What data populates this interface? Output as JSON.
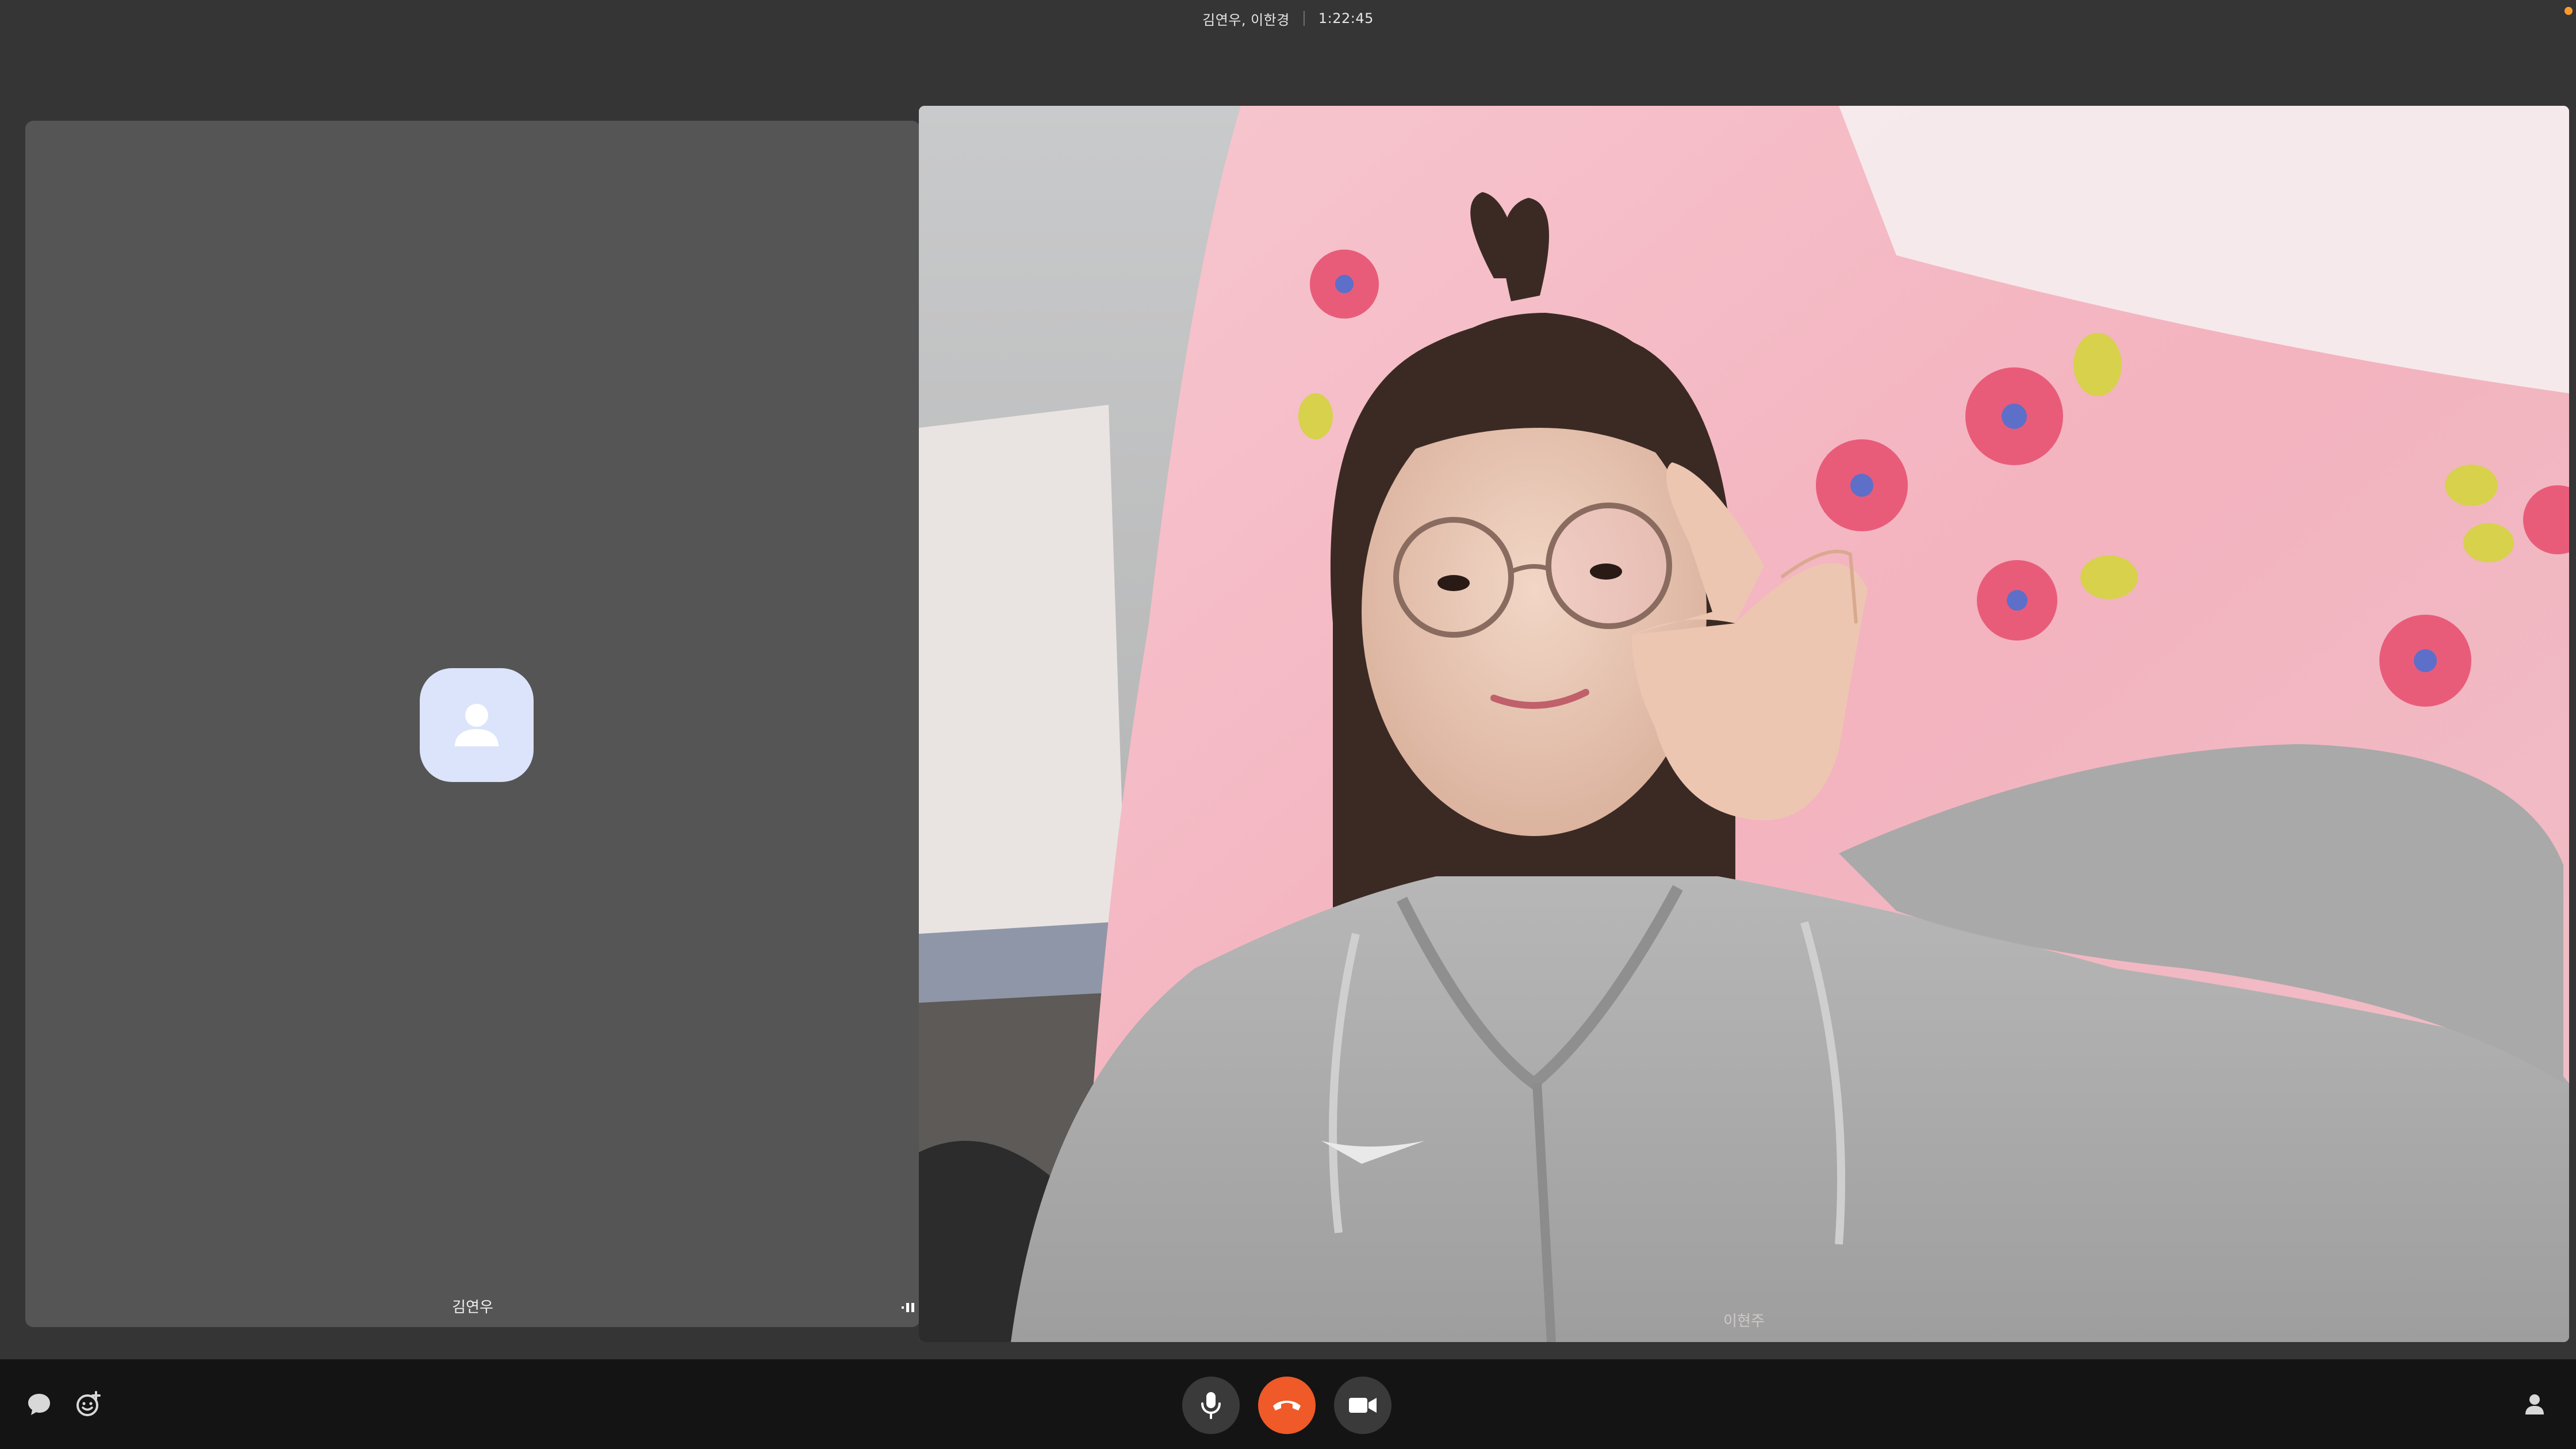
{
  "window": {
    "participants_title": "김연우, 이한경",
    "call_timer": "1:22:45"
  },
  "tiles": {
    "left": {
      "name": "김연우",
      "video": "off",
      "avatar_icon": "person-icon"
    },
    "right": {
      "name": "이현주",
      "video": "on"
    }
  },
  "controls": {
    "mic_icon": "microphone-icon",
    "end_call_icon": "phone-hangup-icon",
    "camera_icon": "video-camera-icon",
    "chat_icon": "chat-bubble-icon",
    "emoji_icon": "emoji-reaction-icon",
    "participants_icon": "person-icon"
  },
  "colors": {
    "end_call": "#f05a28",
    "avatar_bg": "#dbe4fb",
    "avatar_fg": "#ffffff",
    "notification": "#ff9a2e"
  }
}
